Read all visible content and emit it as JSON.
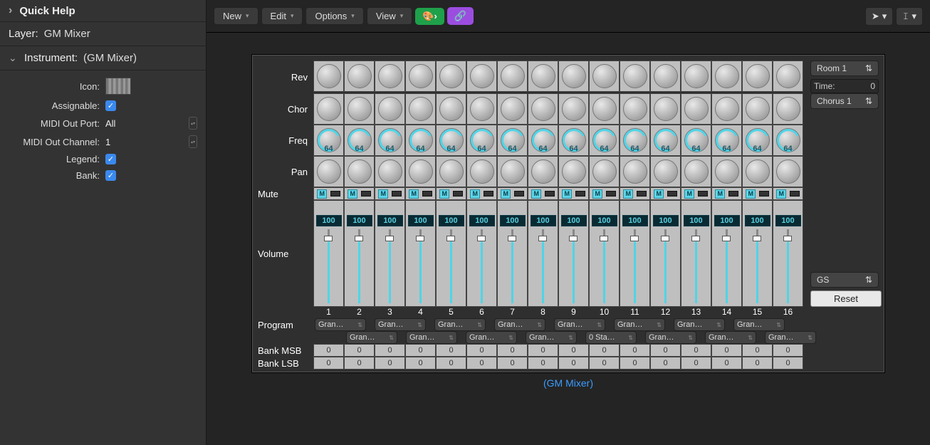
{
  "left": {
    "quick_help": "Quick Help",
    "layer_label": "Layer:",
    "layer_value": "GM Mixer",
    "instrument_label": "Instrument:",
    "instrument_value": "(GM Mixer)",
    "icon_label": "Icon:",
    "assignable_label": "Assignable:",
    "midi_port_label": "MIDI Out Port:",
    "midi_port_value": "All",
    "midi_ch_label": "MIDI Out Channel:",
    "midi_ch_value": "1",
    "legend_label": "Legend:",
    "bank_label": "Bank:"
  },
  "toolbar": {
    "new": "New",
    "edit": "Edit",
    "options": "Options",
    "view": "View",
    "palette_icon": "🎨›",
    "link_icon": "🔗"
  },
  "mixer": {
    "rows": {
      "rev": "Rev",
      "chor": "Chor",
      "freq": "Freq",
      "pan": "Pan",
      "mute": "Mute",
      "volume": "Volume",
      "program": "Program",
      "bank_msb": "Bank MSB",
      "bank_lsb": "Bank LSB"
    },
    "freq_value": "64",
    "mute_letter": "M",
    "volume_value": "100",
    "channels": [
      "1",
      "2",
      "3",
      "4",
      "5",
      "6",
      "7",
      "8",
      "9",
      "10",
      "11",
      "12",
      "13",
      "14",
      "15",
      "16"
    ],
    "program_top": [
      "Gran…",
      "Gran…",
      "Gran…",
      "Gran…",
      "Gran…",
      "Gran…",
      "Gran…",
      "Gran…"
    ],
    "program_bottom": [
      "Gran…",
      "Gran…",
      "Gran…",
      "Gran…",
      "0 Sta…",
      "Gran…",
      "Gran…",
      "Gran…"
    ],
    "bank_msb": [
      "0",
      "0",
      "0",
      "0",
      "0",
      "0",
      "0",
      "0",
      "0",
      "0",
      "0",
      "0",
      "0",
      "0",
      "0",
      "0"
    ],
    "bank_lsb": [
      "0",
      "0",
      "0",
      "0",
      "0",
      "0",
      "0",
      "0",
      "0",
      "0",
      "0",
      "0",
      "0",
      "0",
      "0",
      "0"
    ],
    "side": {
      "room": "Room 1",
      "time_label": "Time:",
      "time_value": "0",
      "chorus": "Chorus 1",
      "mode": "GS",
      "reset": "Reset"
    },
    "caption": "(GM Mixer)"
  }
}
